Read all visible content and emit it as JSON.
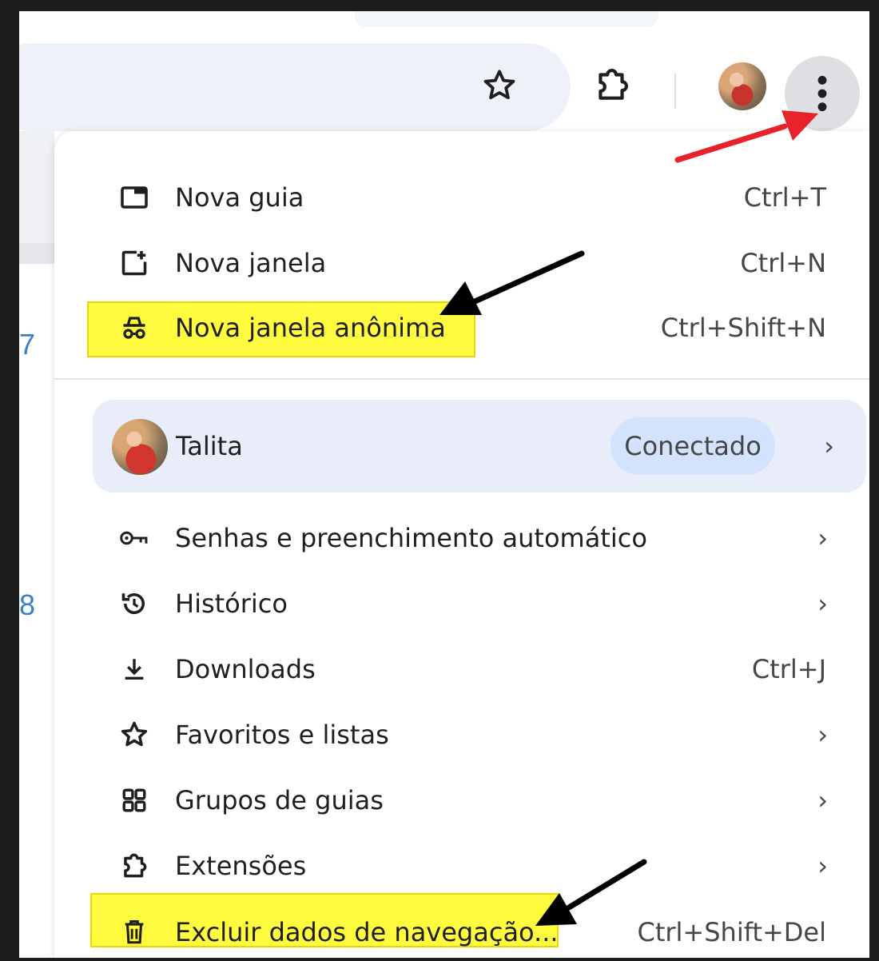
{
  "toolbar": {
    "bookmark_icon": "star-outline-icon",
    "extensions_icon": "puzzle-icon",
    "menu_icon": "kebab-vertical-icon"
  },
  "background": {
    "side_numbers": [
      "7",
      "8"
    ]
  },
  "menu": {
    "items_top": [
      {
        "label": "Nova guia",
        "shortcut": "Ctrl+T",
        "icon": "new-tab-icon"
      },
      {
        "label": "Nova janela",
        "shortcut": "Ctrl+N",
        "icon": "new-window-icon"
      },
      {
        "label": "Nova janela anônima",
        "shortcut": "Ctrl+Shift+N",
        "icon": "incognito-icon"
      }
    ],
    "profile": {
      "name": "Talita",
      "status": "Conectado"
    },
    "items_bottom": [
      {
        "label": "Senhas e preenchimento automático",
        "icon": "key-icon"
      },
      {
        "label": "Histórico",
        "icon": "history-icon"
      },
      {
        "label": "Downloads",
        "shortcut": "Ctrl+J",
        "icon": "download-icon"
      },
      {
        "label": "Favoritos e listas",
        "icon": "star-icon"
      },
      {
        "label": "Grupos de guias",
        "icon": "tab-groups-icon"
      },
      {
        "label": "Extensões",
        "icon": "puzzle-icon"
      },
      {
        "label": "Excluir dados de navegação...",
        "shortcut": "Ctrl+Shift+Del",
        "icon": "trash-icon"
      }
    ],
    "chevron": "›"
  },
  "colors": {
    "highlight": "#fffb3f",
    "red_arrow": "#e8222a",
    "black_arrow": "#000000",
    "profile_bg": "#e8edf9",
    "badge_bg": "#d3e3fd",
    "kebab_bg": "#dedfe3"
  }
}
